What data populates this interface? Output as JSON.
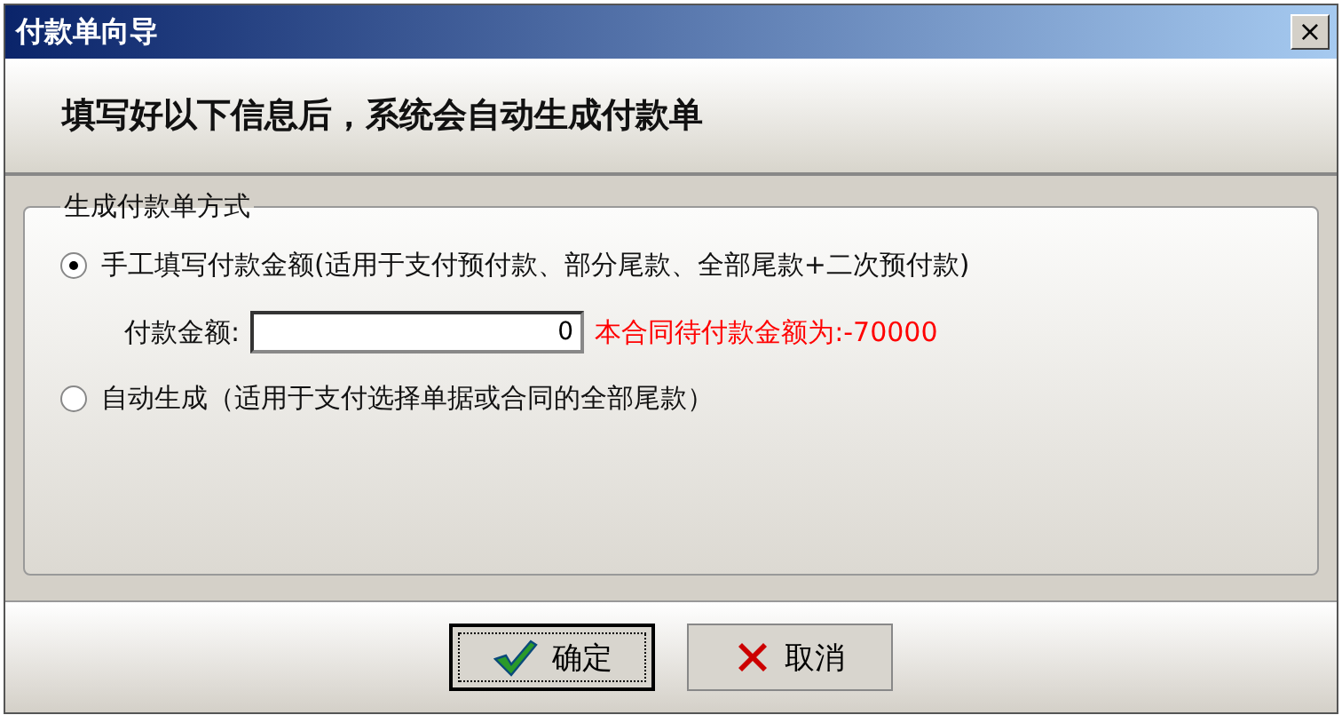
{
  "window": {
    "title": "付款单向导",
    "close": "×"
  },
  "header": "填写好以下信息后，系统会自动生成付款单",
  "group": {
    "title": "生成付款单方式",
    "options": [
      {
        "label": "手工填写付款金额(适用于支付预付款、部分尾款、全部尾款+二次预付款)",
        "selected": true
      },
      {
        "label": "自动生成（适用于支付选择单据或合同的全部尾款）",
        "selected": false
      }
    ],
    "amount": {
      "label": "付款金额:",
      "value": "0",
      "note": "本合同待付款金额为:-70000"
    }
  },
  "buttons": [
    {
      "kind": "ok",
      "label": "确定",
      "focused": true
    },
    {
      "kind": "cancel",
      "label": "取消",
      "focused": false
    }
  ]
}
